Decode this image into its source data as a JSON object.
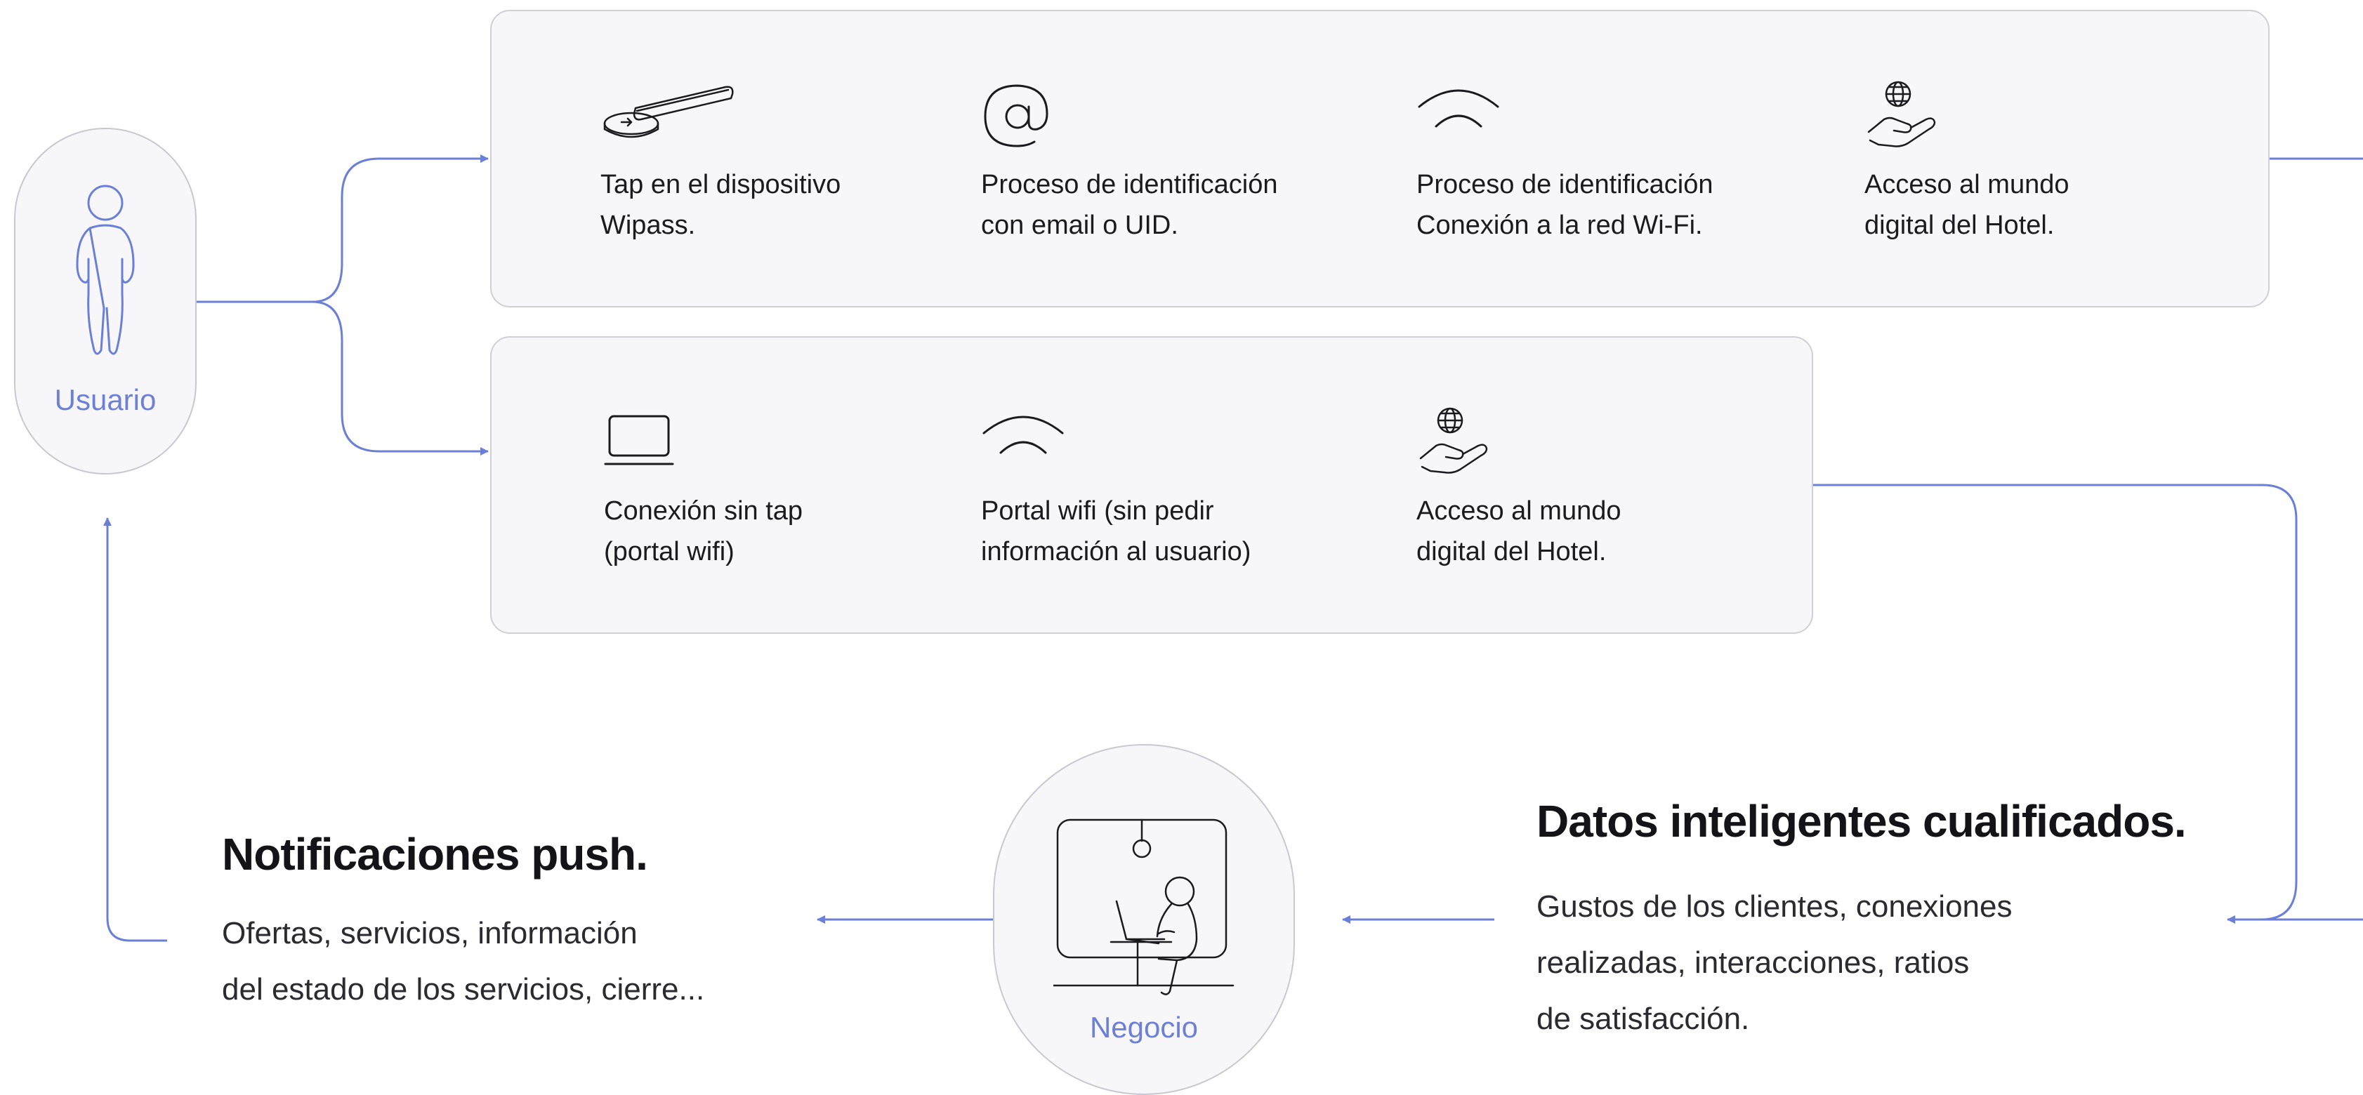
{
  "colors": {
    "connector": "#6b7fd7",
    "box_bg": "#f7f7f9",
    "box_border": "#cfcfd6",
    "node_label": "#6e7fd6"
  },
  "nodes": {
    "user": {
      "label": "Usuario",
      "icon": "person-icon"
    },
    "business": {
      "label": "Negocio",
      "icon": "person-at-laptop-icon"
    }
  },
  "flow_with_tap": {
    "steps": [
      {
        "icon": "wipass-tap-device-icon",
        "lines": [
          "Tap en el dispositivo",
          "Wipass."
        ]
      },
      {
        "icon": "at-sign-icon",
        "lines": [
          "Proceso de identificación",
          "con email o UID."
        ]
      },
      {
        "icon": "wifi-icon",
        "lines": [
          "Proceso de identificación",
          "Conexión a la red Wi-Fi."
        ]
      },
      {
        "icon": "globe-hand-icon",
        "lines": [
          "Acceso al mundo",
          "digital del Hotel."
        ]
      }
    ]
  },
  "flow_without_tap": {
    "steps": [
      {
        "icon": "laptop-icon",
        "lines": [
          "Conexión sin tap",
          "(portal wifi)"
        ]
      },
      {
        "icon": "wifi-icon",
        "lines": [
          "Portal wifi (sin pedir",
          "información al usuario)"
        ]
      },
      {
        "icon": "globe-hand-icon",
        "lines": [
          "Acceso al mundo",
          "digital del Hotel."
        ]
      }
    ]
  },
  "smart_data": {
    "title": "Datos inteligentes cualificados.",
    "lines": [
      "Gustos de los clientes, conexiones",
      "realizadas, interacciones, ratios",
      "de satisfacción."
    ]
  },
  "push_notifications": {
    "title": "Notificaciones push.",
    "lines": [
      "Ofertas, servicios, información",
      "del estado de los servicios, cierre..."
    ]
  }
}
